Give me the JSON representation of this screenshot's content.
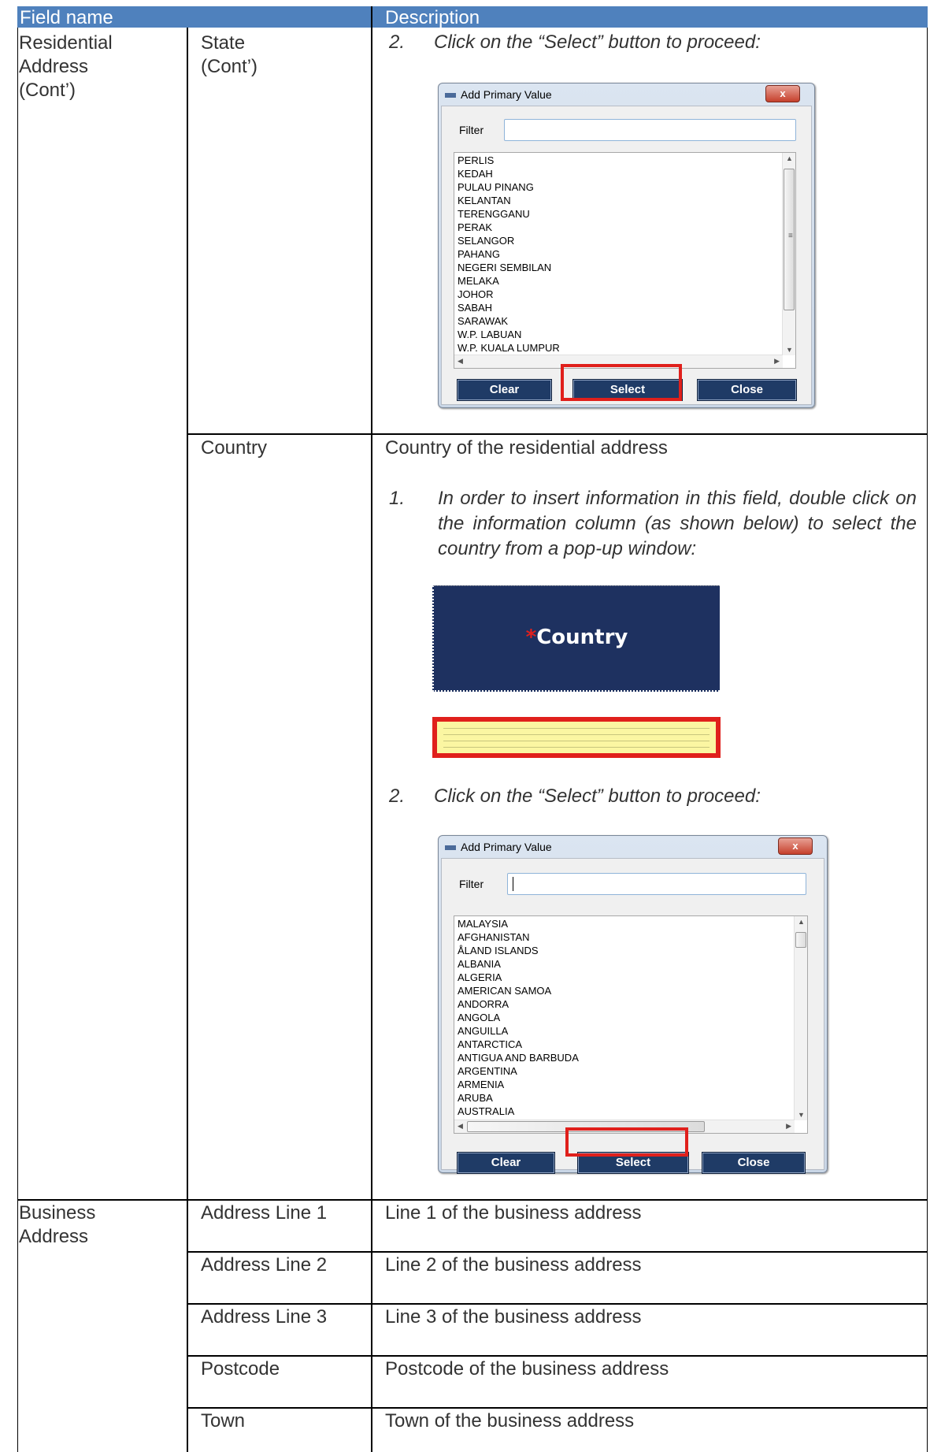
{
  "header": {
    "col1": "Field name",
    "col2": "Description"
  },
  "residential": {
    "group": [
      "Residential",
      "Address",
      "(Cont’)"
    ],
    "state_label": [
      "State",
      "(Cont’)"
    ],
    "state_step2": {
      "num": "2.",
      "text": "Click on the “Select” button to proceed:"
    },
    "country_label": "Country",
    "country_desc": "Country of the residential address",
    "country_step1": {
      "num": "1.",
      "text": "In order to insert information in this field, double click on the information column (as shown below) to select the country from a pop-up window:"
    },
    "country_field_label": "Country",
    "country_field_asterisk": "*",
    "country_step2": {
      "num": "2.",
      "text": "Click on the “Select” button to proceed:"
    }
  },
  "dialog_state": {
    "title": "Add Primary Value",
    "close_glyph": "x",
    "filter_label": "Filter",
    "filter_value": "",
    "items": [
      "PERLIS",
      "KEDAH",
      "PULAU PINANG",
      "KELANTAN",
      "TERENGGANU",
      "PERAK",
      "SELANGOR",
      "PAHANG",
      "NEGERI SEMBILAN",
      "MELAKA",
      "JOHOR",
      "SABAH",
      "SARAWAK",
      "W.P. LABUAN",
      "W.P. KUALA LUMPUR"
    ],
    "buttons": {
      "clear": "Clear",
      "select": "Select",
      "close": "Close"
    }
  },
  "dialog_country": {
    "title": "Add Primary Value",
    "close_glyph": "x",
    "filter_label": "Filter",
    "filter_value": "",
    "items": [
      "MALAYSIA",
      "AFGHANISTAN",
      "ÅLAND ISLANDS",
      "ALBANIA",
      "ALGERIA",
      "AMERICAN SAMOA",
      "ANDORRA",
      "ANGOLA",
      "ANGUILLA",
      "ANTARCTICA",
      "ANTIGUA AND BARBUDA",
      "ARGENTINA",
      "ARMENIA",
      "ARUBA",
      "AUSTRALIA"
    ],
    "buttons": {
      "clear": "Clear",
      "select": "Select",
      "close": "Close"
    }
  },
  "business": {
    "group": [
      "Business",
      "Address"
    ],
    "rows": [
      {
        "field": "Address Line 1",
        "desc": "Line 1 of the business address"
      },
      {
        "field": "Address Line 2",
        "desc": "Line 2 of the business address"
      },
      {
        "field": "Address Line 3",
        "desc": "Line 3 of the business address"
      },
      {
        "field": "Postcode",
        "desc": "Postcode of the business address"
      },
      {
        "field": "Town",
        "desc": "Town of the business address"
      }
    ]
  },
  "colors": {
    "header": "#4f81bd",
    "highlight": "#e0201c",
    "button": "#1f3b66",
    "field_bg": "#1e3160",
    "input_bg": "#fbf6a2"
  }
}
